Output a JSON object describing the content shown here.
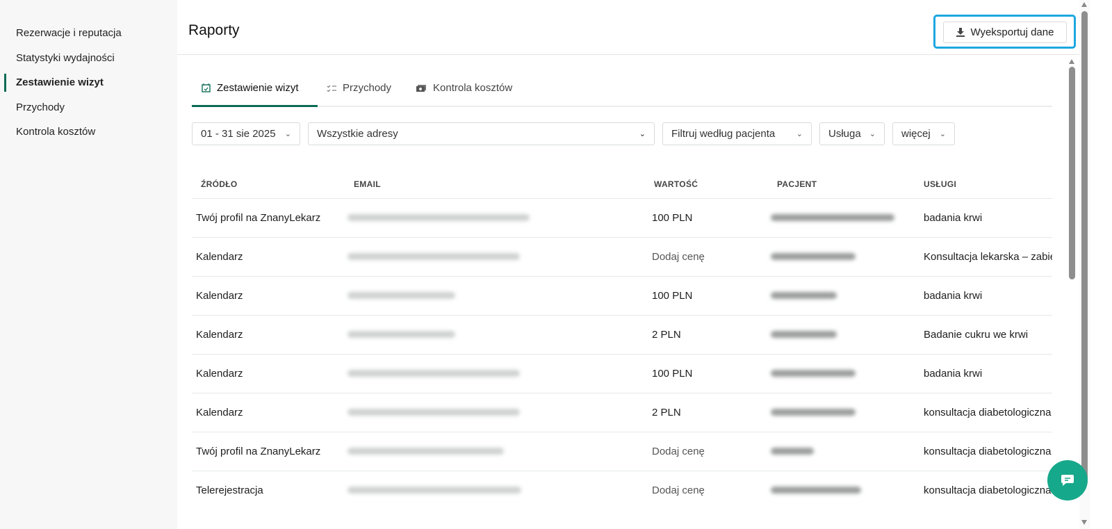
{
  "sidebar": {
    "items": [
      {
        "label": "Rezerwacje i reputacja"
      },
      {
        "label": "Statystyki wydajności"
      },
      {
        "label": "Zestawienie wizyt",
        "active": true
      },
      {
        "label": "Przychody"
      },
      {
        "label": "Kontrola kosztów"
      }
    ]
  },
  "header": {
    "title": "Raporty",
    "export_label": "Wyeksportuj dane"
  },
  "tabs": [
    {
      "label": "Zestawienie wizyt",
      "icon": "calendar-check-icon"
    },
    {
      "label": "Przychody",
      "icon": "checklist-icon"
    },
    {
      "label": "Kontrola kosztów",
      "icon": "money-icon"
    }
  ],
  "filters": {
    "date": "01 - 31 sie 2025",
    "address": "Wszystkie adresy",
    "patient": "Filtruj według pacjenta",
    "service": "Usługa",
    "more": "więcej"
  },
  "table": {
    "columns": [
      "ŹRÓDŁO",
      "EMAIL",
      "WARTOŚĆ",
      "PACJENT",
      "USŁUGI"
    ],
    "rows": [
      {
        "source": "Twój profil na ZnanyLekarz",
        "value": "100 PLN",
        "service": "badania krwi"
      },
      {
        "source": "Kalendarz",
        "value": "Dodaj cenę",
        "service": "Konsultacja lekarska – zabieg"
      },
      {
        "source": "Kalendarz",
        "value": "100 PLN",
        "service": "badania krwi"
      },
      {
        "source": "Kalendarz",
        "value": "2 PLN",
        "service": "Badanie cukru we krwi"
      },
      {
        "source": "Kalendarz",
        "value": "100 PLN",
        "service": "badania krwi"
      },
      {
        "source": "Kalendarz",
        "value": "2 PLN",
        "service": "konsultacja diabetologiczna"
      },
      {
        "source": "Twój profil na ZnanyLekarz",
        "value": "Dodaj cenę",
        "service": "konsultacja diabetologiczna"
      },
      {
        "source": "Telerejestracja",
        "value": "Dodaj cenę",
        "service": "konsultacja diabetologiczna"
      }
    ]
  },
  "colors": {
    "accent": "#0b6b55",
    "highlight": "#1ca7e0",
    "chat": "#16a88a"
  }
}
